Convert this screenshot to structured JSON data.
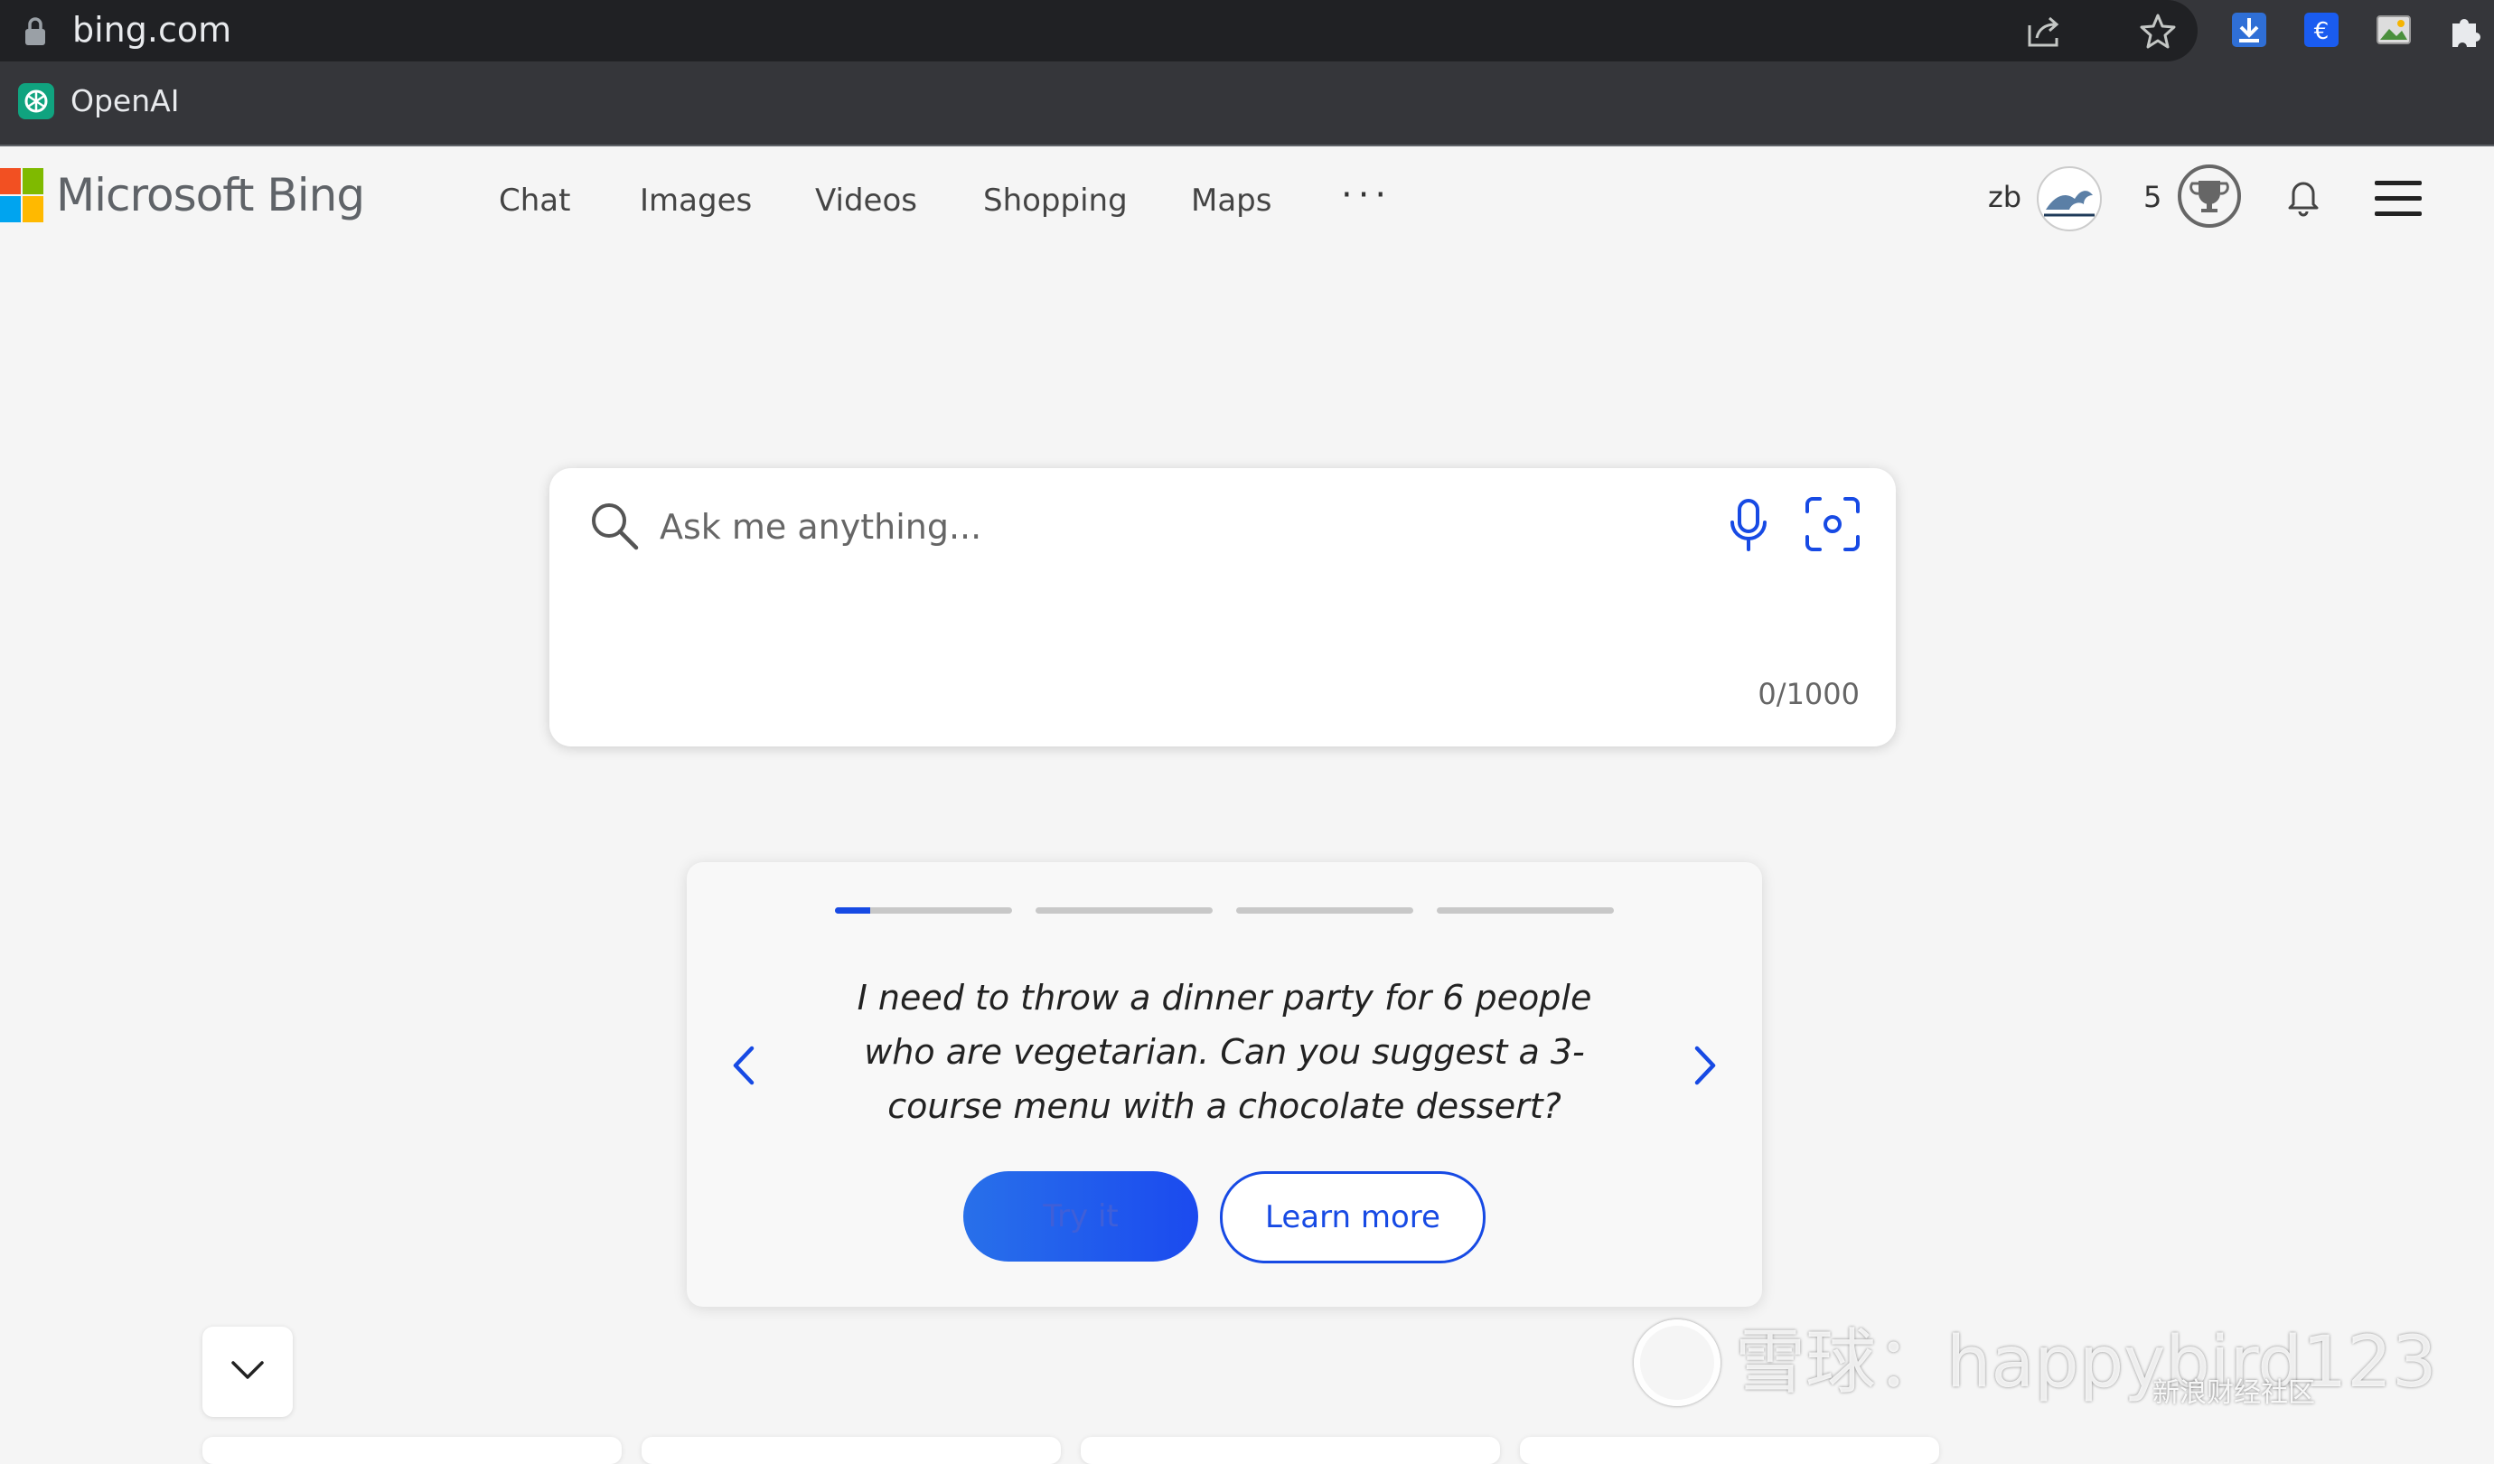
{
  "browser": {
    "url": "bing.com",
    "bookmark_label": "OpenAI"
  },
  "header": {
    "brand": "Microsoft Bing",
    "nav": [
      "Chat",
      "Images",
      "Videos",
      "Shopping",
      "Maps"
    ],
    "more": "···",
    "user_initials": "zb",
    "reward_points": "5"
  },
  "search": {
    "placeholder": "Ask me anything...",
    "counter": "0/1000"
  },
  "suggestion": {
    "prompt": "I need to throw a dinner party for 6 people who are vegetarian. Can you suggest a 3-course menu with a chocolate dessert?",
    "try_label": "Try it",
    "learn_label": "Learn more",
    "progress": [
      0.2,
      0,
      0,
      0
    ]
  },
  "watermark": {
    "text": "雪球：happybird123",
    "sina": "新浪财经社区"
  },
  "colors": {
    "accent": "#174ae4",
    "page_bg": "#f5f5f5"
  }
}
